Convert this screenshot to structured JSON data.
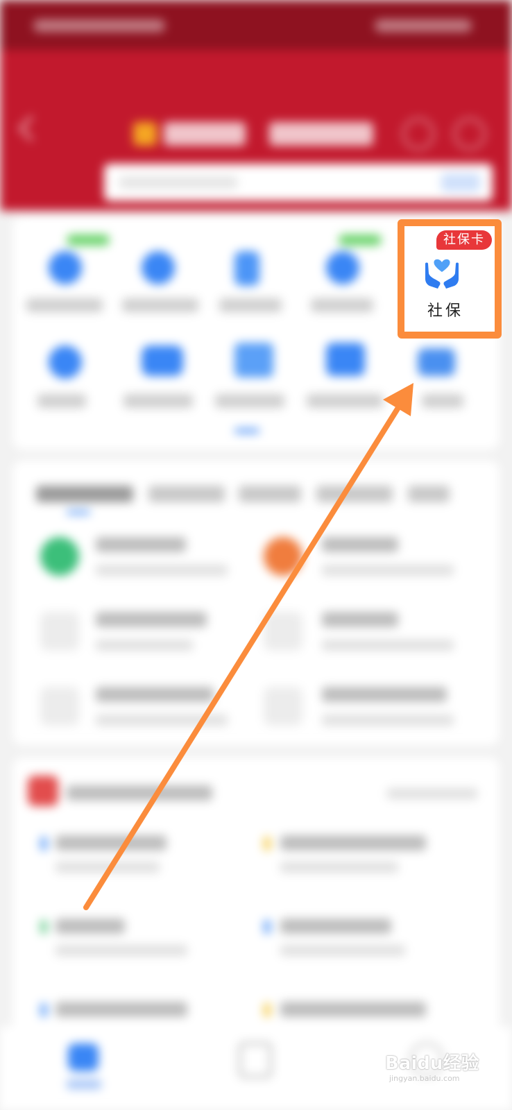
{
  "highlight": {
    "badge": "社保卡",
    "label": "社保",
    "icon": "hands-heart-icon",
    "border_color": "#fb8c3c",
    "badge_color": "#e8373a",
    "icon_color": "#2f7cf0"
  },
  "annotation": {
    "arrow_color": "#fb8c3c",
    "arrow_icon": "pointer-arrow-icon"
  },
  "watermark": {
    "text": "Baidu经验",
    "sub": "jingyan.baidu.com"
  },
  "colors": {
    "header_red": "#c2192d",
    "status_bar": "#8e1220"
  }
}
